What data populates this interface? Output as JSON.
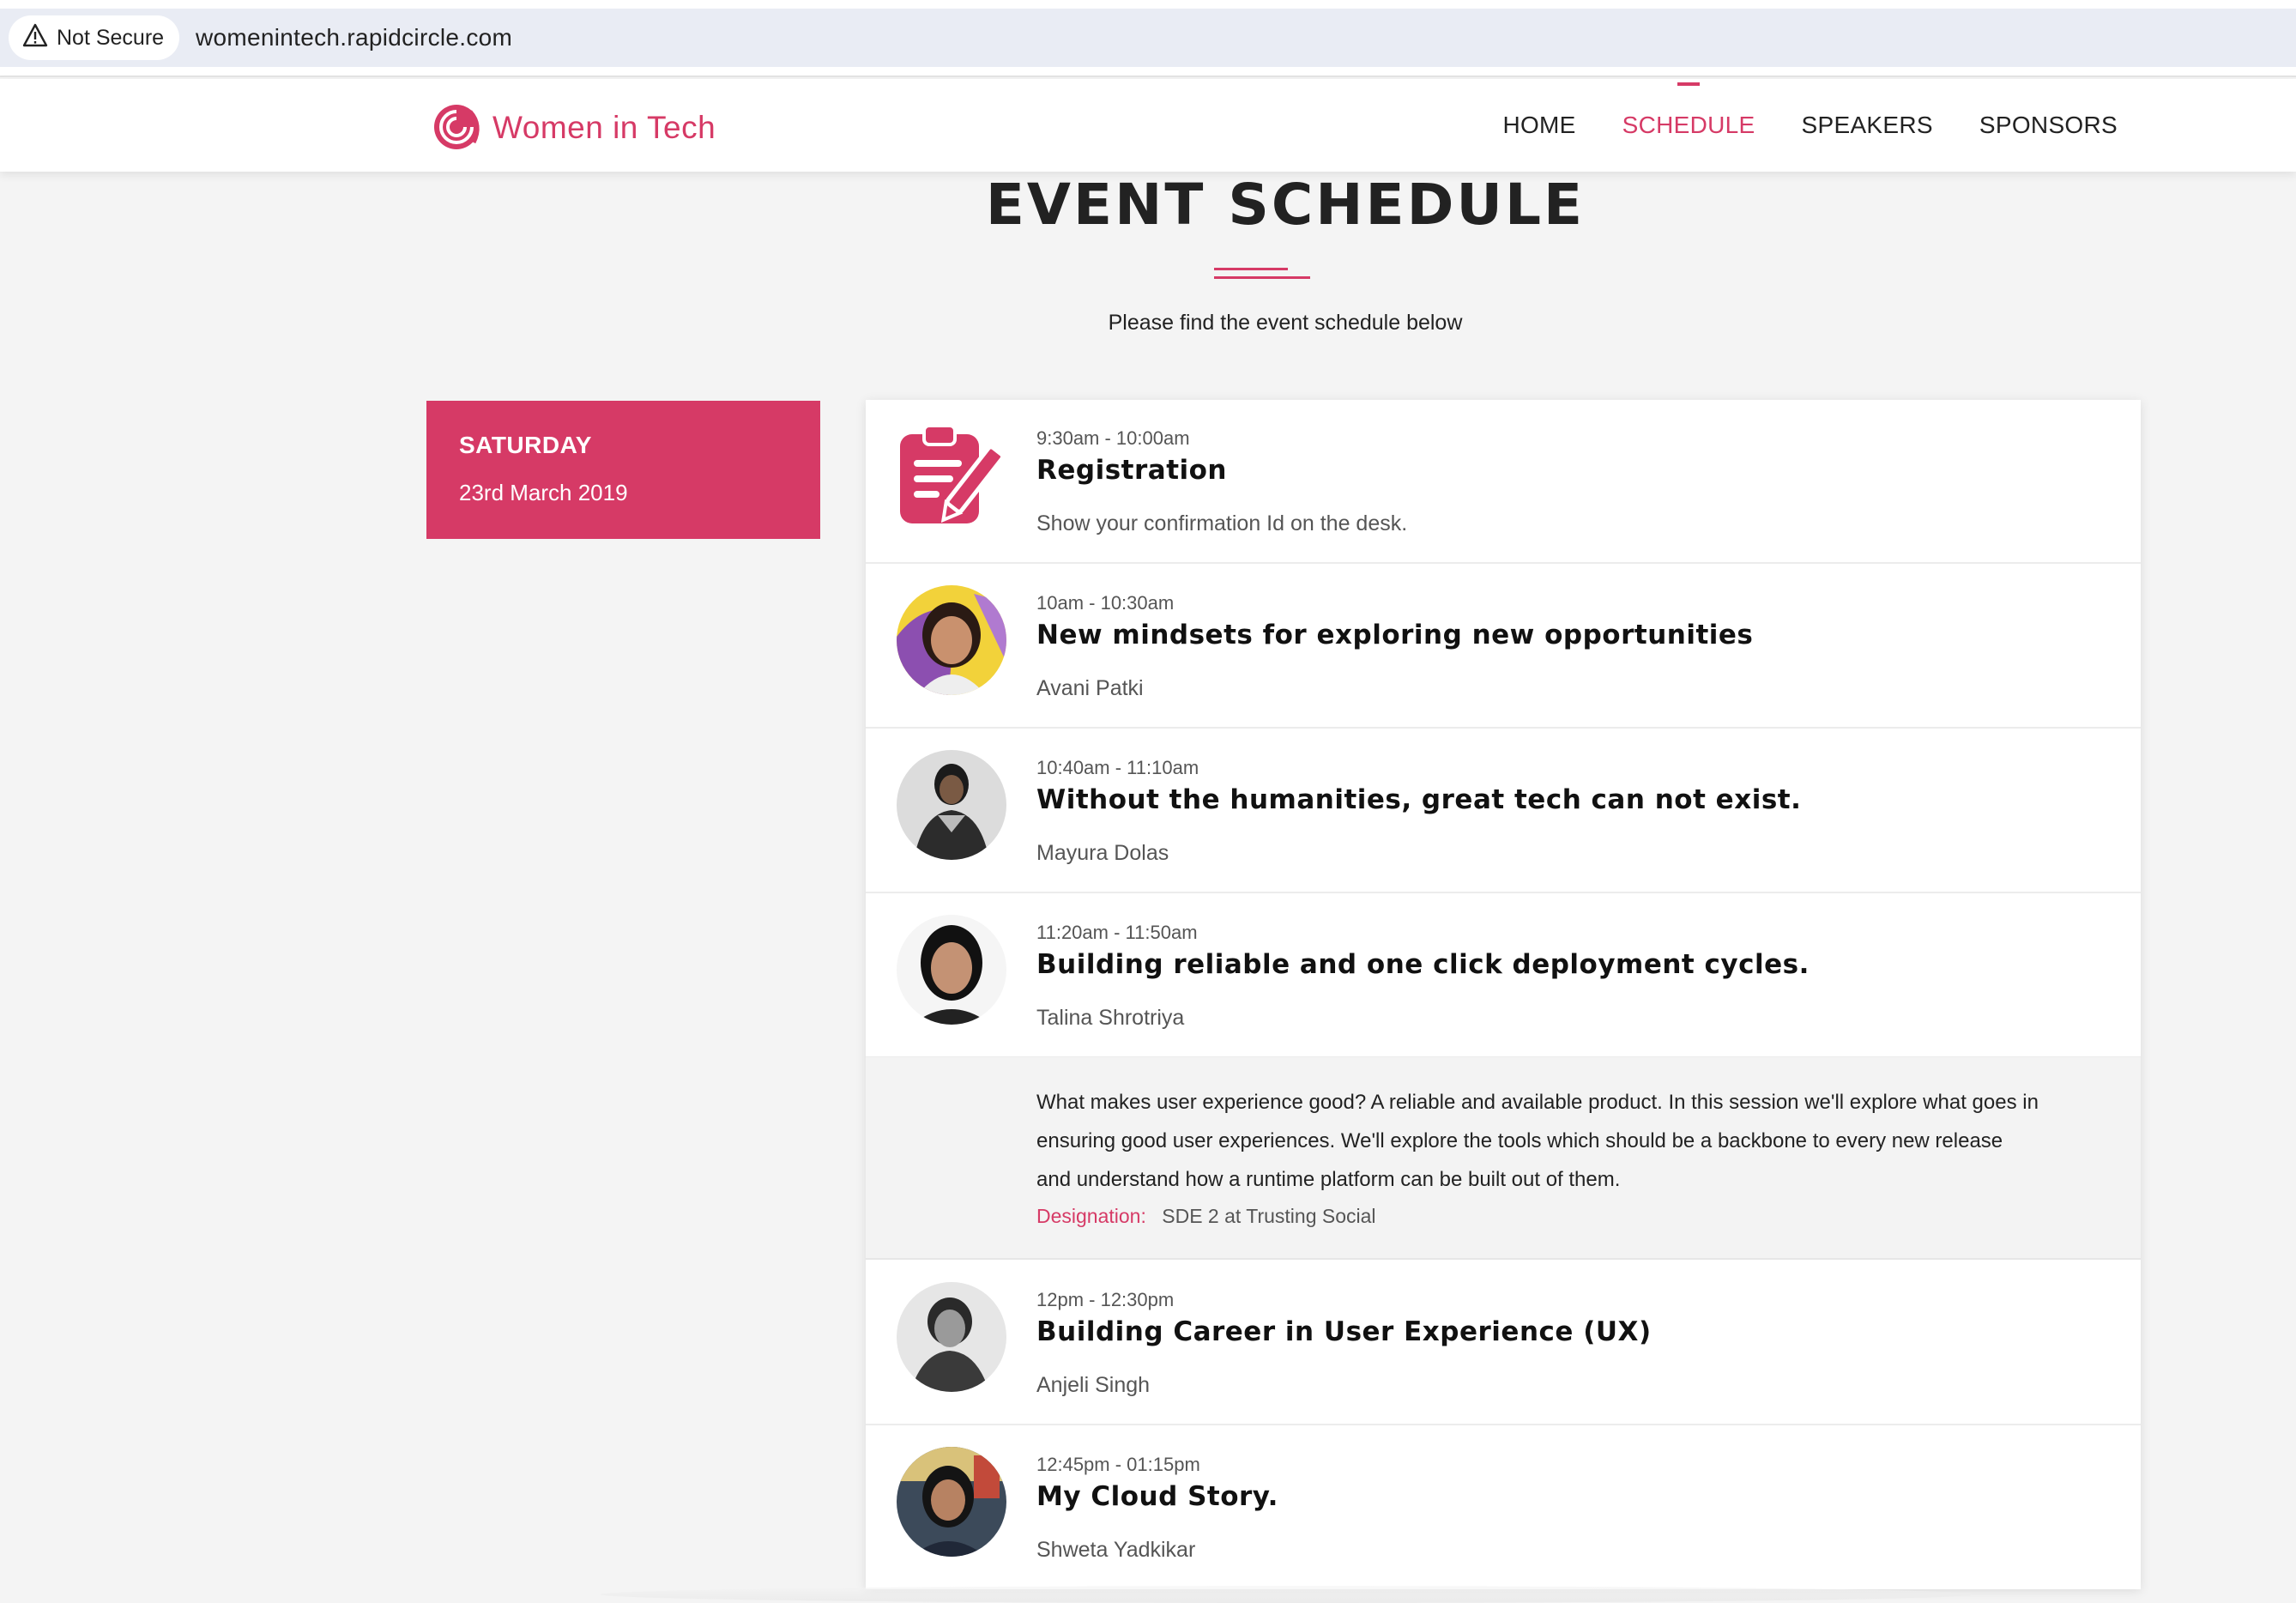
{
  "browser": {
    "security_label": "Not Secure",
    "url": "womenintech.rapidcircle.com"
  },
  "site": {
    "logo_text": "Women in Tech",
    "brand_color": "#d63a66",
    "nav": [
      {
        "label": "HOME",
        "active": false
      },
      {
        "label": "SCHEDULE",
        "active": true
      },
      {
        "label": "SPEAKERS",
        "active": false
      },
      {
        "label": "SPONSORS",
        "active": false
      }
    ]
  },
  "page": {
    "title": "EVENT SCHEDULE",
    "subtitle": "Please find the event schedule below"
  },
  "day": {
    "name": "SATURDAY",
    "date": "23rd March 2019"
  },
  "sessions": [
    {
      "time": "9:30am - 10:00am",
      "title": "Registration",
      "speaker": "Show your confirmation Id on the desk.",
      "icon": "clipboard-pen-icon"
    },
    {
      "time": "10am - 10:30am",
      "title": "New mindsets for exploring new opportunities",
      "speaker": "Avani Patki"
    },
    {
      "time": "10:40am - 11:10am",
      "title": "Without the humanities, great tech can not exist.",
      "speaker": "Mayura Dolas"
    },
    {
      "time": "11:20am - 11:50am",
      "title": "Building reliable and one click deployment cycles.",
      "speaker": "Talina Shrotriya"
    },
    {
      "time": "12pm - 12:30pm",
      "title": "Building Career in User Experience (UX)",
      "speaker": "Anjeli Singh"
    },
    {
      "time": "12:45pm - 01:15pm",
      "title": "My Cloud Story.",
      "speaker": "Shweta Yadkikar"
    }
  ],
  "expanded": {
    "description": "What makes user experience good? A reliable and available product. In this session we'll explore what goes in ensuring good user experiences. We'll explore the tools which should be a backbone to every new release and understand how a runtime platform can be built out of them.",
    "designation_label": "Designation:",
    "designation_value": "SDE 2 at Trusting Social"
  }
}
